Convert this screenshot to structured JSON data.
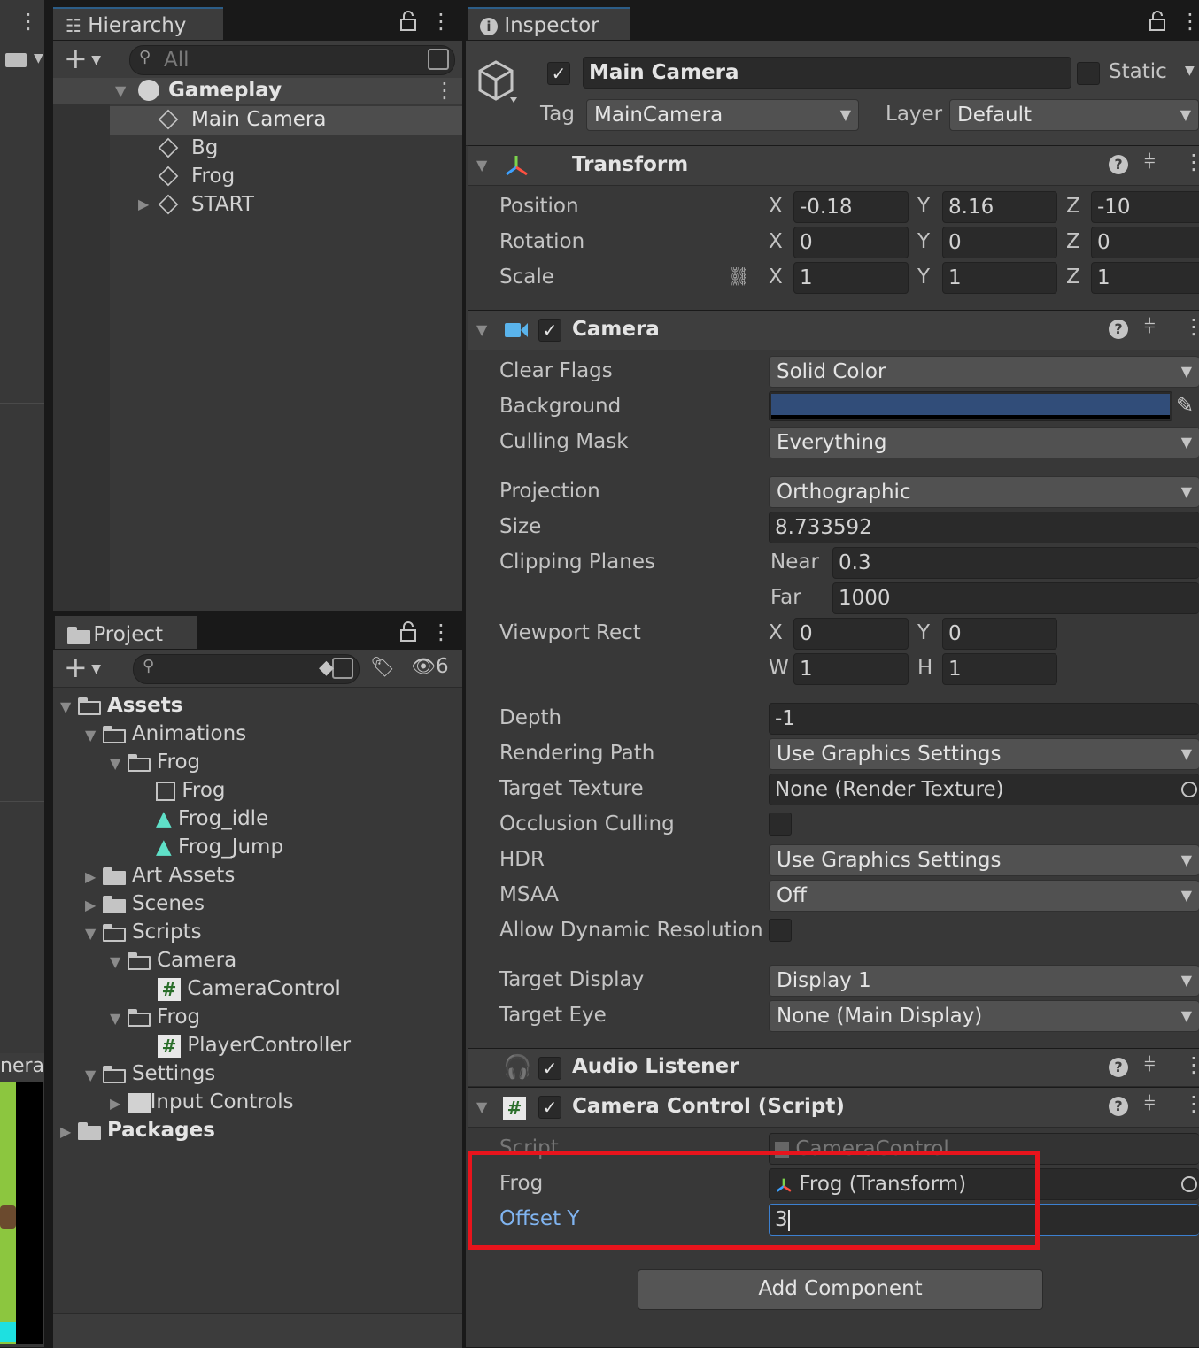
{
  "hierarchy": {
    "tab_label": "Hierarchy",
    "search_placeholder": "All",
    "scene_name": "Gameplay",
    "items": [
      "Main Camera",
      "Bg",
      "Frog",
      "START"
    ]
  },
  "project": {
    "tab_label": "Project",
    "hidden_count": "6",
    "tree": {
      "assets": "Assets",
      "animations": "Animations",
      "frog_folder": "Frog",
      "frog_controller": "Frog",
      "frog_idle": "Frog_idle",
      "frog_jump": "Frog_Jump",
      "art_assets": "Art Assets",
      "scenes": "Scenes",
      "scripts": "Scripts",
      "camera_folder": "Camera",
      "camera_control": "CameraControl",
      "frog_scripts_folder": "Frog",
      "player_controller": "PlayerController",
      "settings": "Settings",
      "input_controls": "Input Controls",
      "packages": "Packages"
    }
  },
  "scene_view": {
    "partial_label": "nera"
  },
  "inspector": {
    "tab_label": "Inspector",
    "object_name": "Main Camera",
    "static_label": "Static",
    "tag_label": "Tag",
    "tag_value": "MainCamera",
    "layer_label": "Layer",
    "layer_value": "Default",
    "transform": {
      "title": "Transform",
      "position_label": "Position",
      "rotation_label": "Rotation",
      "scale_label": "Scale",
      "axis_x": "X",
      "axis_y": "Y",
      "axis_z": "Z",
      "position": [
        "-0.18",
        "8.16",
        "-10"
      ],
      "rotation": [
        "0",
        "0",
        "0"
      ],
      "scale": [
        "1",
        "1",
        "1"
      ]
    },
    "camera": {
      "title": "Camera",
      "clear_flags_label": "Clear Flags",
      "clear_flags_value": "Solid Color",
      "background_label": "Background",
      "background_color": "#314d79",
      "culling_mask_label": "Culling Mask",
      "culling_mask_value": "Everything",
      "projection_label": "Projection",
      "projection_value": "Orthographic",
      "size_label": "Size",
      "size_value": "8.733592",
      "clipping_label": "Clipping Planes",
      "near_label": "Near",
      "near_value": "0.3",
      "far_label": "Far",
      "far_value": "1000",
      "viewport_label": "Viewport Rect",
      "vp_x_label": "X",
      "vp_x": "0",
      "vp_y_label": "Y",
      "vp_y": "0",
      "vp_w_label": "W",
      "vp_w": "1",
      "vp_h_label": "H",
      "vp_h": "1",
      "depth_label": "Depth",
      "depth_value": "-1",
      "rendering_path_label": "Rendering Path",
      "rendering_path_value": "Use Graphics Settings",
      "target_texture_label": "Target Texture",
      "target_texture_value": "None (Render Texture)",
      "occlusion_label": "Occlusion Culling",
      "hdr_label": "HDR",
      "hdr_value": "Use Graphics Settings",
      "msaa_label": "MSAA",
      "msaa_value": "Off",
      "dynamic_res_label": "Allow Dynamic Resolution",
      "target_display_label": "Target Display",
      "target_display_value": "Display 1",
      "target_eye_label": "Target Eye",
      "target_eye_value": "None (Main Display)"
    },
    "audio_listener": {
      "title": "Audio Listener"
    },
    "camera_control": {
      "title": "Camera Control (Script)",
      "script_label": "Script",
      "script_value": "CameraControl",
      "frog_label": "Frog",
      "frog_value": "Frog (Transform)",
      "offset_label": "Offset Y",
      "offset_value": "3"
    },
    "add_component_label": "Add Component"
  },
  "colors": {
    "highlight_box": "#e8141c",
    "accent_blue": "#80b4f0"
  }
}
